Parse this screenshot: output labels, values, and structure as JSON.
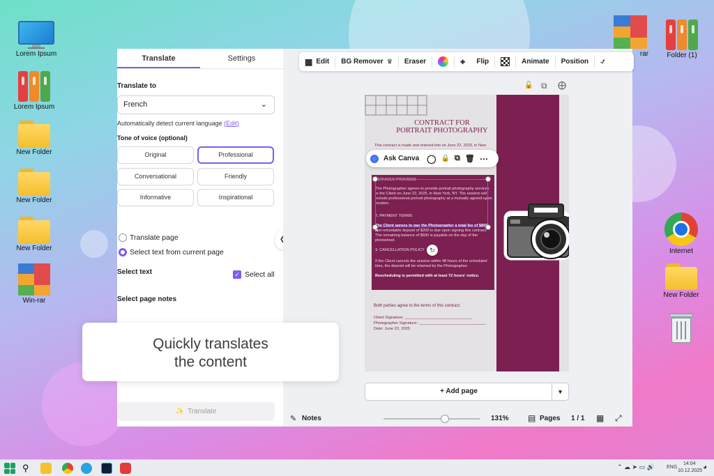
{
  "desktop": {
    "icons_left": [
      {
        "label": "Lorem Ipsum",
        "type": "monitor"
      },
      {
        "label": "Lorem Ipsum",
        "type": "binders"
      },
      {
        "label": "New Folder",
        "type": "folder"
      },
      {
        "label": "New Folder",
        "type": "folder"
      },
      {
        "label": "New Folder",
        "type": "folder"
      },
      {
        "label": "Win-rar",
        "type": "winrar"
      }
    ],
    "icons_right": [
      {
        "label": "rar",
        "type": "winrar"
      },
      {
        "label": "Folder (1)",
        "type": "binders"
      },
      {
        "label": "Internet",
        "type": "chrome"
      },
      {
        "label": "New Folder",
        "type": "folder"
      },
      {
        "label": "",
        "type": "recycle-bin"
      }
    ]
  },
  "panel": {
    "tabs": [
      {
        "label": "Translate"
      },
      {
        "label": "Settings"
      }
    ],
    "translate_to_label": "Translate to",
    "language": "French",
    "detect_text": "Automatically detect current language",
    "detect_edit": "(Edit)",
    "tone_label": "Tone of voice (optional)",
    "tones": [
      "Original",
      "Professional",
      "Conversational",
      "Friendly",
      "Informative",
      "Inspirational"
    ],
    "selected_tone": "Professional",
    "radio_translate_page": "Translate page",
    "radio_select_text": "Select text from current page",
    "select_text_label": "Select text",
    "select_all_label": "Select all",
    "select_notes_label": "Select page notes",
    "translate_button": "Translate"
  },
  "toolbar": {
    "edit": "Edit",
    "bg_remover": "BG Remover",
    "eraser": "Eraser",
    "flip": "Flip",
    "animate": "Animate",
    "position": "Position"
  },
  "ask_canva": {
    "label": "Ask Canva"
  },
  "document": {
    "title_line1": "CONTRACT FOR",
    "title_line2": "PORTRAIT PHOTOGRAPHY",
    "intro": "This contract is made and entered into on June 22, 2025, in New",
    "services_heading": "SERVICES PROVIDED",
    "services_body": "The Photographer agrees to provide portrait photography services to the Client on June 22, 2025, in New York, NY. The session will include professional portrait photography at a mutually agreed-upon location.",
    "payment_heading": "2. PAYMENT TERMS",
    "payment_bold": "The Client agrees to pay the Photographer a total fee of $800. A",
    "payment_body": "non-refundable deposit of $200 is due upon signing this contract. The remaining balance of $600 is payable on the day of the photoshoot.",
    "cancel_heading": "3. CANCELLATION POLICY",
    "cancel_body": "If the Client cancels the session within 48 hours of the scheduled time, the deposit will be retained by the Photographer.",
    "resched": "Rescheduling is permitted with at least 72 hours' notice.",
    "agree": "Both parties agree to the terms of this contract.",
    "client_sig": "Client Signature: ______________________________",
    "photographer_sig": "Photographer Signature: ______________________________",
    "date": "Date: June 22, 2025"
  },
  "add_page": "+ Add page",
  "bottombar": {
    "notes": "Notes",
    "zoom": "131%",
    "zoom_fraction": 0.5,
    "pages": "Pages",
    "page_count": "1 / 1"
  },
  "overlay": {
    "line1": "Quickly translates",
    "line2": "the content"
  },
  "taskbar": {
    "lang": "ENG",
    "time": "14:04",
    "date": "10.12.2025"
  }
}
